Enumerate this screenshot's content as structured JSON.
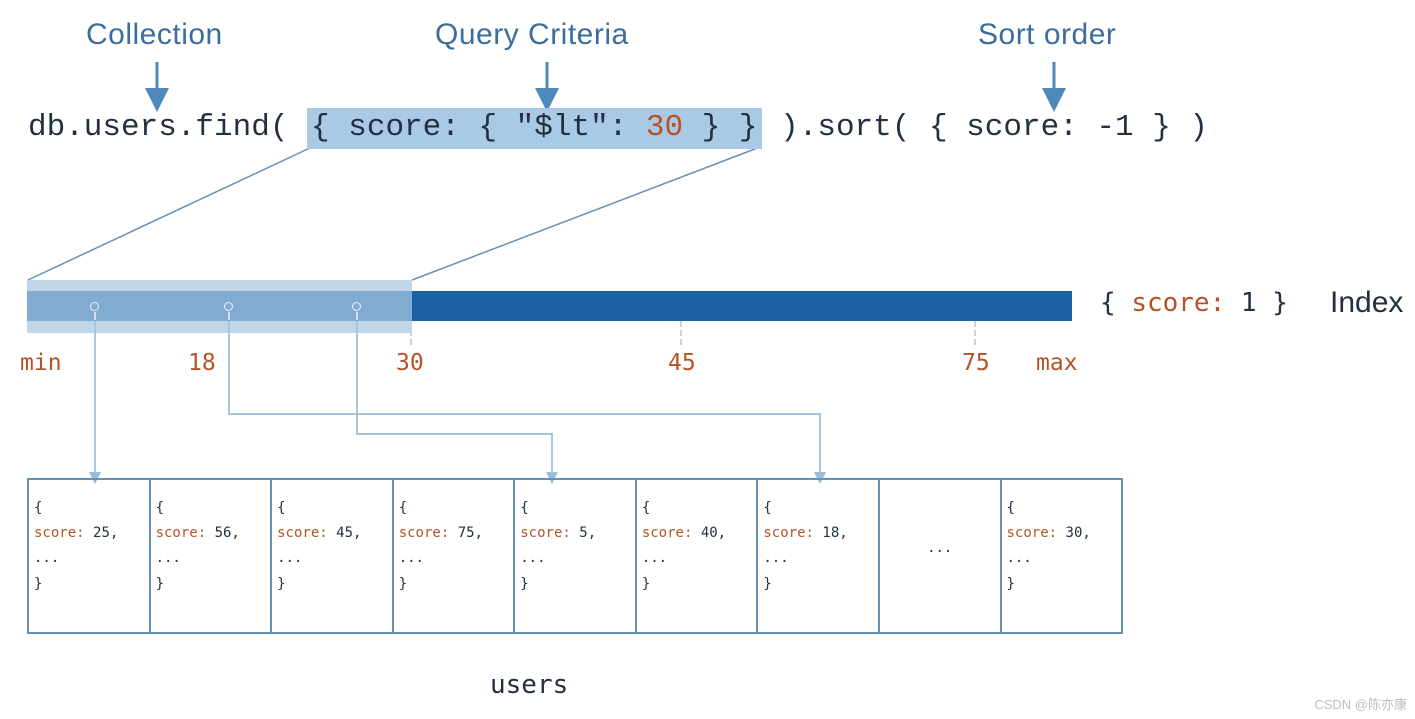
{
  "labels": {
    "collection": "Collection",
    "querycriteria": "Query Criteria",
    "sortorder": "Sort order"
  },
  "code": {
    "pre": "db.users.find( ",
    "crit_open": "{ score: { \"$lt\": ",
    "crit_val": "30",
    "crit_close": " } }",
    "mid": " ).sort( { score: -1 } )"
  },
  "ticks": {
    "min": "min",
    "t18": "18",
    "t30": "30",
    "t45": "45",
    "t75": "75",
    "max": "max"
  },
  "index": {
    "open": "{ ",
    "key": "score:",
    "val": " 1 ",
    "close": "}",
    "word": "Index"
  },
  "docs": [
    "25",
    "56",
    "45",
    "75",
    "5",
    "40",
    "18",
    null,
    "30"
  ],
  "doc_template": {
    "open": "{",
    "prefix": "  score: ",
    "suffix": ",",
    "dots": "...",
    "close": "}"
  },
  "users": "users",
  "watermark": "CSDN @陈亦康"
}
